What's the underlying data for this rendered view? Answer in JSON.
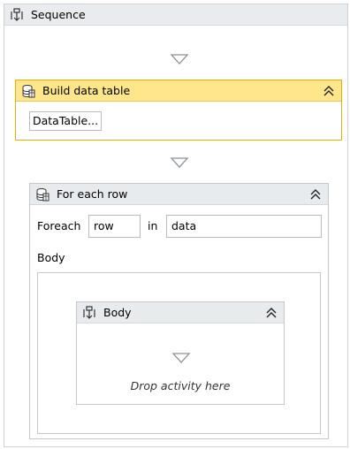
{
  "sequence": {
    "title": "Sequence",
    "icon": "sequence-icon"
  },
  "build_data_table": {
    "title": "Build data table",
    "icon": "data-table-icon",
    "button_label": "DataTable...",
    "accent": "#ffe68a"
  },
  "for_each_row": {
    "title": "For each row",
    "icon": "data-table-icon",
    "foreach_label": "Foreach",
    "item_value": "row",
    "in_label": "in",
    "collection_value": "data",
    "body_label": "Body"
  },
  "body": {
    "title": "Body",
    "icon": "sequence-icon",
    "drop_text": "Drop activity here"
  }
}
